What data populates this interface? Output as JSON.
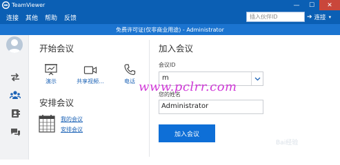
{
  "titlebar": {
    "app_title": "TeamViewer",
    "minimize": "—",
    "maximize": "☐",
    "close": "✕"
  },
  "menu": {
    "items": [
      "连接",
      "其他",
      "帮助",
      "反馈"
    ]
  },
  "partner": {
    "placeholder": "插入伙伴ID",
    "connect_label": "连接",
    "connect_arrow": "➔",
    "connect_chevron": "▾"
  },
  "license": {
    "text": "免费许可证(仅非商业用途) - Administrator"
  },
  "start_meeting": {
    "title": "开始会议",
    "actions": [
      {
        "label": "演示",
        "icon": "presentation-icon"
      },
      {
        "label": "共享视频...",
        "icon": "video-camera-icon"
      },
      {
        "label": "电话",
        "icon": "phone-icon"
      }
    ]
  },
  "schedule_meeting": {
    "title": "安排会议",
    "links": [
      "我的会议",
      "安排会议"
    ]
  },
  "join_meeting": {
    "title": "加入会议",
    "id_label": "会议ID",
    "id_value": "m",
    "name_label": "您的姓名",
    "name_value": "Administrator",
    "join_button": "加入会议"
  },
  "nav": {
    "icons": [
      "remote-control-icon",
      "meeting-icon",
      "contacts-icon",
      "chat-icon"
    ]
  },
  "watermark": {
    "text": "www.pclrr.com",
    "baidu": "Bai经验"
  },
  "colors": {
    "titlebar": "#0b5fb4",
    "license_bar": "#1b74d0",
    "join_button": "#0e6fd7",
    "link": "#1c63b6",
    "watermark": "#d13ad8"
  }
}
